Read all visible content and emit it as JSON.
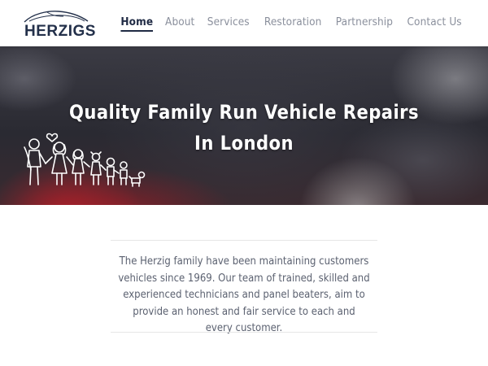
{
  "header": {
    "logo_text": "HERZIGS",
    "nav": [
      "Home",
      "About",
      "Services",
      "Restoration",
      "Partnership",
      "Contact Us"
    ],
    "active_nav": "Home"
  },
  "hero": {
    "title_line1": "Quality Family Run Vehicle Repairs",
    "title_line2": "In London"
  },
  "intro": {
    "text": "The Herzig family have been maintaining customers vehicles since 1969. Our team of trained, skilled and experienced technicians and panel beaters, aim to provide an honest and fair service to each and every customer."
  },
  "colors": {
    "brand": "#23304a",
    "nav_inactive": "#8a8f9c",
    "body_text": "#5b6170"
  }
}
